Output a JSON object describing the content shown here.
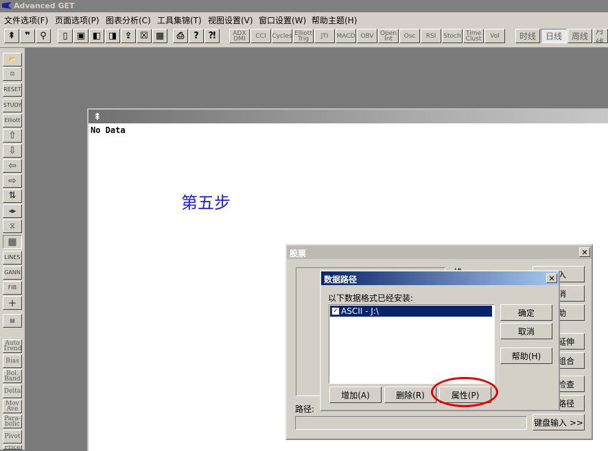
{
  "app": {
    "title": "Advanced GET"
  },
  "menu": [
    "文件选项(F)",
    "页面选项(P)",
    "图表分析(C)",
    "工具集锦(T)",
    "视图设置(V)",
    "窗口设置(W)",
    "帮助主题(H)"
  ],
  "toolbar": {
    "icons": [
      "pin-icon",
      "quote-icon",
      "magnifier-icon",
      "new-page-icon",
      "save-icon",
      "back-icon",
      "forward-icon",
      "export-icon",
      "close-chart-icon",
      "grid-icon",
      "print-icon",
      "help-icon",
      "context-help-icon"
    ],
    "indicators": [
      "ADX DMI",
      "CCI",
      "Cycles",
      "Elliott Trig",
      "JTI",
      "MACD",
      "OBV",
      "Open Int",
      "Osc",
      "RSI",
      "Stoch",
      "Time Clust",
      "Vol"
    ],
    "periods": [
      "时线",
      "日线",
      "周线",
      "月线"
    ],
    "active_period": "日线"
  },
  "left_toolbar": {
    "buttons": [
      "open-icon",
      "scale-icon",
      "RESET",
      "STUDY",
      "Elliott",
      "up-arrow-icon",
      "down-arrow-icon",
      "left-arrow-icon",
      "right-arrow-icon",
      "swap-icon",
      "expand-icon",
      "compress-icon",
      "grid-select-icon",
      "LINES",
      "GANN",
      "FIB",
      "cross-icon",
      "props-icon"
    ],
    "text_buttons": [
      "Auto Trend",
      "Bias",
      "Bol. Band",
      "Delta",
      "Mov Ave",
      "Para- bolic",
      "Pivot",
      "Price"
    ]
  },
  "chart_window": {
    "status_text": "No Data",
    "annotation": "第五步"
  },
  "stock_dialog": {
    "title": "股票",
    "path_label": "路径:",
    "path_value": "",
    "keyboard_button": "键盘输入 >>",
    "partial_labels": [
      "线",
      "入",
      "消",
      "助",
      "延伸",
      "组合",
      "检查",
      "路径"
    ]
  },
  "data_path_dialog": {
    "title": "数据路径",
    "label": "以下数据格式已经安装:",
    "items": [
      {
        "label": "ASCII - J:\\",
        "checked": true,
        "selected": true
      }
    ],
    "buttons": {
      "ok": "确定",
      "cancel": "取消",
      "help": "帮助(H)",
      "add": "增加(A)",
      "delete": "删除(R)",
      "properties": "属性(P)"
    },
    "highlighted_button": "属性(P)"
  },
  "colors": {
    "title_selected": "#0a246a",
    "annotation": "#2020d0",
    "highlight_circle": "#e00000",
    "background": "#7a7a7a"
  }
}
